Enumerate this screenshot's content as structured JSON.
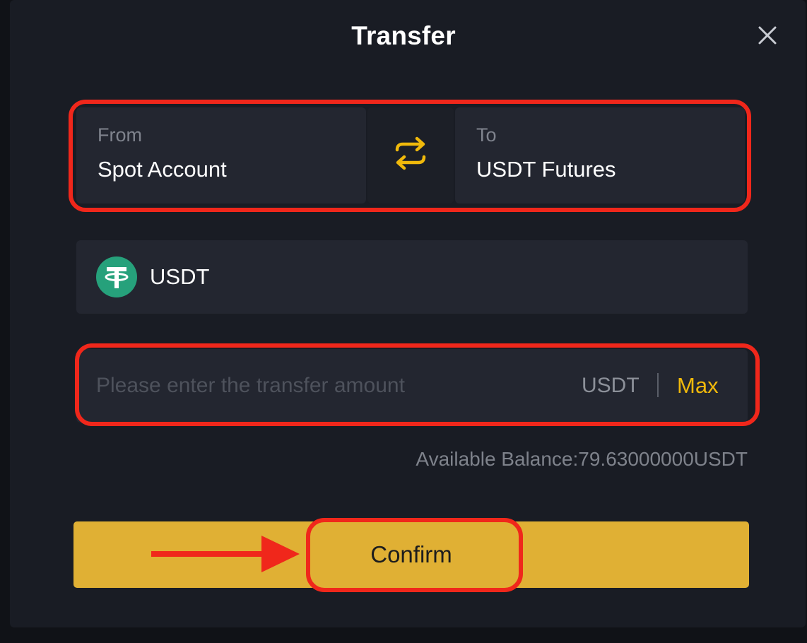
{
  "dialog": {
    "title": "Transfer"
  },
  "from": {
    "label": "From",
    "value": "Spot Account"
  },
  "to": {
    "label": "To",
    "value": "USDT Futures"
  },
  "coin": {
    "name": "USDT",
    "icon": "tether-icon"
  },
  "amount": {
    "placeholder": "Please enter the transfer amount",
    "value": "",
    "unit": "USDT",
    "max_label": "Max"
  },
  "balance": {
    "text": "Available Balance:79.63000000USDT"
  },
  "confirm": {
    "label": "Confirm"
  },
  "colors": {
    "accent": "#f0b90b",
    "confirm_bg": "#e0b034",
    "highlight": "#f0271b",
    "tether": "#26a17b"
  }
}
